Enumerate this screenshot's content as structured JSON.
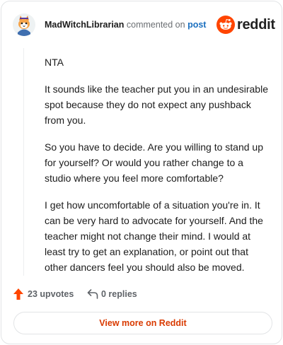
{
  "header": {
    "username": "MadWitchLibrarian",
    "action_text": "commented on",
    "post_link": "post",
    "brand_wordmark": "reddit",
    "avatar_icon": "cat-avatar-icon",
    "brand_icon": "reddit-snoo-icon"
  },
  "comment": {
    "paragraphs": [
      "NTA",
      "It sounds like the teacher put you in an undesirable spot because they do not expect any pushback from you.",
      "So you have to decide. Are you willing to stand up for yourself? Or would you rather change to a studio where you feel more comfortable?",
      "I get how uncomfortable of a situation you're in. It can be very hard to advocate for yourself. And the teacher might not change their mind. I would at least try to get an explanation, or point out that other dancers feel you should also be moved."
    ]
  },
  "footer": {
    "upvotes": "23 upvotes",
    "replies": "0 replies",
    "upvote_icon": "upvote-arrow-icon",
    "reply_icon": "reply-arrow-icon"
  },
  "view_more_label": "View more on Reddit",
  "colors": {
    "brand_orange": "#ff4500",
    "link_blue": "#1a6fbf",
    "view_more_text": "#d93a00",
    "muted_text": "#5f6368"
  }
}
